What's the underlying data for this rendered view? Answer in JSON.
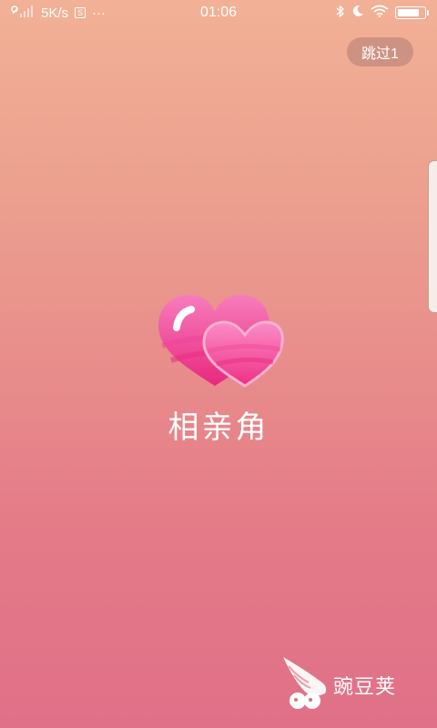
{
  "status_bar": {
    "network_speed": "5K/s",
    "notification_badge": "S",
    "more": "···",
    "time": "01:06",
    "battery_level": 0.85,
    "icons": [
      "signal-icon",
      "notification-icon",
      "bluetooth-icon",
      "moon-icon",
      "wifi-icon",
      "battery-icon"
    ]
  },
  "splash": {
    "skip_label": "跳过1",
    "app_name": "相亲角",
    "logo_icon": "double-heart-logo-icon"
  },
  "watermark": {
    "brand_text": "豌豆荚",
    "icon": "wandoujia-pea-icon"
  },
  "colors": {
    "background_top": "#f2b196",
    "background_bottom": "#e07088",
    "logo_pink": "#f24f9c",
    "logo_light": "#f77dbd",
    "skip_bg": "#a06e69"
  }
}
